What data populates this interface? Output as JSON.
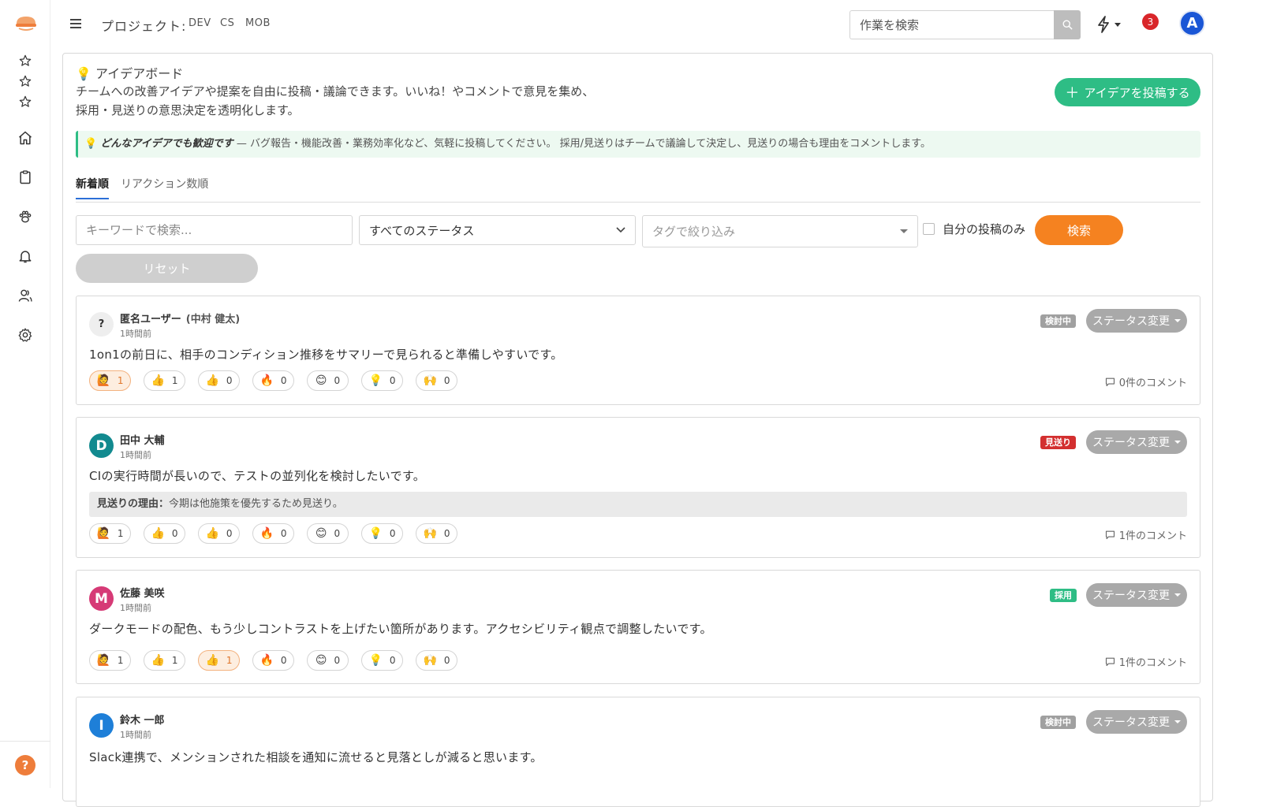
{
  "header": {
    "project_label": "プロジェクト:",
    "projects": [
      "DEV",
      "CS",
      "MOB"
    ],
    "search_placeholder": "作業を検索",
    "notification_count": "3",
    "user_initial": "A"
  },
  "sidebar": {
    "icons": [
      "star-icon",
      "star-icon",
      "star-icon",
      "home-icon",
      "clipboard-icon",
      "paw-icon",
      "bell-icon",
      "users-icon",
      "gear-icon"
    ],
    "help": "?"
  },
  "page": {
    "title": "アイデアボード",
    "description_line1": "チームへの改善アイデアや提案を自由に投稿・議論できます。いいね！やコメントで意見を集め、",
    "description_line2": "採用・見送りの意思決定を透明化します。",
    "post_button": "アイデアを投稿する",
    "notice_bold": "どんなアイデアでも歓迎です",
    "notice_text": " — バグ報告・機能改善・業務効率化など、気軽に投稿してください。 採用/見送りはチームで議論して決定し、見送りの場合も理由をコメントします。"
  },
  "tabs": [
    {
      "label": "新着順",
      "active": true
    },
    {
      "label": "リアクション数順",
      "active": false
    }
  ],
  "filters": {
    "keyword_placeholder": "キーワードで検索...",
    "status_selected": "すべてのステータス",
    "tag_placeholder": "タグで絞り込み",
    "mine_only_label": "自分の投稿のみ",
    "search_button": "検索",
    "reset_button": "リセット"
  },
  "status_change_label": "ステータス変更",
  "ideas": [
    {
      "avatar": "?",
      "avatar_color": "#eeeeee",
      "author": "匿名ユーザー",
      "author_sub": "(中村 健太)",
      "time": "1時間前",
      "status": "検討中",
      "status_color": "#a0a0a0",
      "body": "1on1の前日に、相手のコンディション推移をサマリーで見られると準備しやすいです。",
      "reason_label": "",
      "reason_text": "",
      "reactions": [
        {
          "emoji": "🙋",
          "count": "1",
          "active": true
        },
        {
          "emoji": "👍",
          "count": "1",
          "active": false
        },
        {
          "emoji": "👍",
          "count": "0",
          "active": false
        },
        {
          "emoji": "🔥",
          "count": "0",
          "active": false
        },
        {
          "emoji": "😊",
          "count": "0",
          "active": false
        },
        {
          "emoji": "💡",
          "count": "0",
          "active": false
        },
        {
          "emoji": "🙌",
          "count": "0",
          "active": false
        }
      ],
      "comments": "0件のコメント"
    },
    {
      "avatar": "D",
      "avatar_color": "#128a8f",
      "author": "田中 大輔",
      "author_sub": "",
      "time": "1時間前",
      "status": "見送り",
      "status_color": "#d32f2f",
      "body": "CIの実行時間が長いので、テストの並列化を検討したいです。",
      "reason_label": "見送りの理由：",
      "reason_text": "今期は他施策を優先するため見送り。",
      "reactions": [
        {
          "emoji": "🙋",
          "count": "1",
          "active": false
        },
        {
          "emoji": "👍",
          "count": "0",
          "active": false
        },
        {
          "emoji": "👍",
          "count": "0",
          "active": false
        },
        {
          "emoji": "🔥",
          "count": "0",
          "active": false
        },
        {
          "emoji": "😊",
          "count": "0",
          "active": false
        },
        {
          "emoji": "💡",
          "count": "0",
          "active": false
        },
        {
          "emoji": "🙌",
          "count": "0",
          "active": false
        }
      ],
      "comments": "1件のコメント"
    },
    {
      "avatar": "M",
      "avatar_color": "#d63a76",
      "author": "佐藤 美咲",
      "author_sub": "",
      "time": "1時間前",
      "status": "採用",
      "status_color": "#2ebd85",
      "body": "ダークモードの配色、もう少しコントラストを上げたい箇所があります。アクセシビリティ観点で調整したいです。",
      "reason_label": "",
      "reason_text": "",
      "reactions": [
        {
          "emoji": "🙋",
          "count": "1",
          "active": false
        },
        {
          "emoji": "👍",
          "count": "1",
          "active": false
        },
        {
          "emoji": "👍",
          "count": "1",
          "active": true
        },
        {
          "emoji": "🔥",
          "count": "0",
          "active": false
        },
        {
          "emoji": "😊",
          "count": "0",
          "active": false
        },
        {
          "emoji": "💡",
          "count": "0",
          "active": false
        },
        {
          "emoji": "🙌",
          "count": "0",
          "active": false
        }
      ],
      "comments": "1件のコメント"
    },
    {
      "avatar": "I",
      "avatar_color": "#1e7fd8",
      "author": "鈴木 一郎",
      "author_sub": "",
      "time": "1時間前",
      "status": "検討中",
      "status_color": "#a0a0a0",
      "body": "Slack連携で、メンションされた相談を通知に流せると見落としが減ると思います。",
      "reason_label": "",
      "reason_text": "",
      "reactions": [],
      "comments": ""
    }
  ]
}
